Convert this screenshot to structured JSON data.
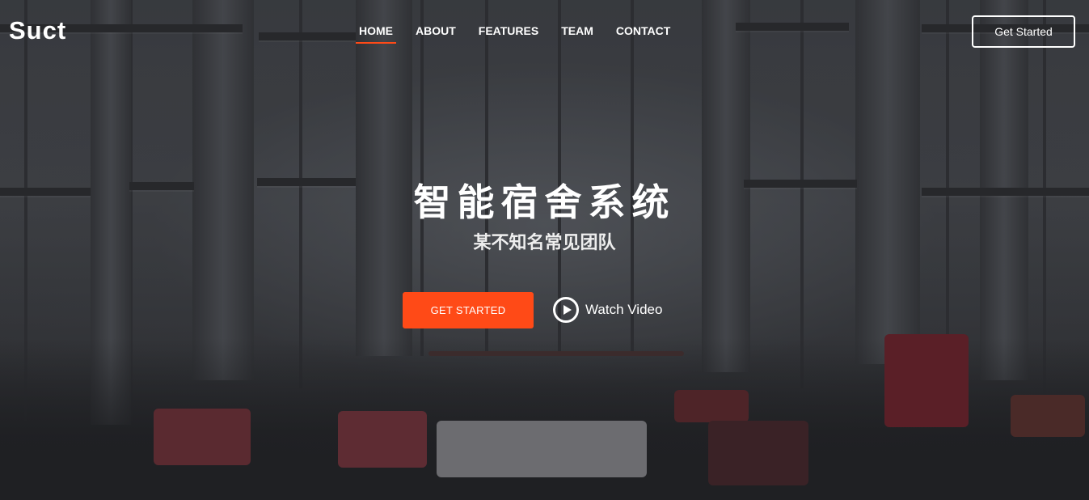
{
  "brand": {
    "logo": "Suct"
  },
  "nav": {
    "items": [
      {
        "label": "HOME",
        "active": true
      },
      {
        "label": "ABOUT",
        "active": false
      },
      {
        "label": "FEATURES",
        "active": false
      },
      {
        "label": "TEAM",
        "active": false
      },
      {
        "label": "CONTACT",
        "active": false
      }
    ],
    "cta_label": "Get Started"
  },
  "hero": {
    "title": "智能宿舍系统",
    "subtitle": "某不知名常见团队",
    "primary_button": "GET STARTED",
    "video_button": "Watch Video",
    "video_icon": "play-circle-icon"
  },
  "colors": {
    "accent": "#ff4a17",
    "text": "#ffffff"
  }
}
